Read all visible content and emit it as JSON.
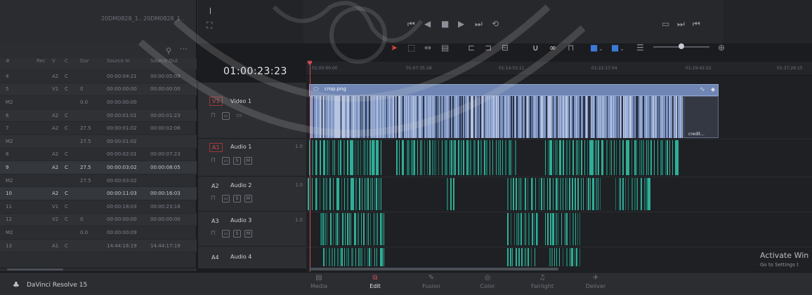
{
  "media_pool": {
    "thumb_labels": [
      "20DM0828_1..",
      "20DM0828_1.."
    ],
    "columns": [
      "#",
      "Rec",
      "V",
      "C",
      "Dur",
      "Source In",
      "Source Out"
    ],
    "rows": [
      {
        "num": "4",
        "v": "A2",
        "c": "C",
        "dur": "",
        "src_in": "00:00:04:21",
        "src_out": "00:00:05:09"
      },
      {
        "num": "5",
        "v": "V1",
        "c": "C",
        "dur": "0",
        "src_in": "00:00:00:00",
        "src_out": "00:00:00:00"
      },
      {
        "num": "M2",
        "v": "",
        "c": "",
        "dur": "0.0",
        "src_in": "00:00:00:00",
        "src_out": ""
      },
      {
        "num": "6",
        "v": "A2",
        "c": "C",
        "dur": "",
        "src_in": "00:00:01:01",
        "src_out": "00:00:01:23"
      },
      {
        "num": "7",
        "v": "A2",
        "c": "C",
        "dur": "27.5",
        "src_in": "00:00:01:02",
        "src_out": "00:00:02:06"
      },
      {
        "num": "M2",
        "v": "",
        "c": "",
        "dur": "27.5",
        "src_in": "00:00:01:02",
        "src_out": ""
      },
      {
        "num": "8",
        "v": "A2",
        "c": "C",
        "dur": "",
        "src_in": "00:00:02:01",
        "src_out": "00:00:07:23"
      },
      {
        "num": "9",
        "v": "A2",
        "c": "C",
        "dur": "27.5",
        "src_in": "00:00:03:02",
        "src_out": "00:00:08:05"
      },
      {
        "num": "M2",
        "v": "",
        "c": "",
        "dur": "27.5",
        "src_in": "00:00:03:02",
        "src_out": ""
      },
      {
        "num": "10",
        "v": "A2",
        "c": "C",
        "dur": "",
        "src_in": "00:00:11:03",
        "src_out": "00:00:16:03"
      },
      {
        "num": "11",
        "v": "V1",
        "c": "C",
        "dur": "",
        "src_in": "00:00:18:03",
        "src_out": "00:00:23:18"
      },
      {
        "num": "12",
        "v": "V2",
        "c": "C",
        "dur": "0",
        "src_in": "00:00:00:00",
        "src_out": "00:00:00:00"
      },
      {
        "num": "M2",
        "v": "",
        "c": "",
        "dur": "0.0",
        "src_in": "00:00:00:09",
        "src_out": ""
      },
      {
        "num": "13",
        "v": "A1",
        "c": "C",
        "dur": "",
        "src_in": "14:44:16:19",
        "src_out": "14:44:17:19"
      }
    ]
  },
  "timeline": {
    "timecode": "01:00:23:23",
    "ruler": [
      "01:00:00:00",
      "01:07:35:18",
      "01:14:53:11",
      "01:22:17:04",
      "01:29:42:22",
      "01:37:29:15"
    ],
    "clip_name": "crop.png",
    "credits_label": "credit..."
  },
  "tracks": [
    {
      "id": "V1",
      "name": "Video 1",
      "count": "",
      "kind": "video"
    },
    {
      "id": "A1",
      "name": "Audio 1",
      "count": "1.0",
      "kind": "audio"
    },
    {
      "id": "A2",
      "name": "Audio 2",
      "count": "1.0",
      "kind": "audio"
    },
    {
      "id": "A3",
      "name": "Audio 3",
      "count": "1.0",
      "kind": "audio"
    },
    {
      "id": "A4",
      "name": "Audio 4",
      "count": "",
      "kind": "audio"
    }
  ],
  "track_buttons": {
    "solo": "S",
    "mute": "M"
  },
  "pages": [
    {
      "label": "Media",
      "icon": "media-icon",
      "active": false
    },
    {
      "label": "Edit",
      "icon": "edit-icon",
      "active": true
    },
    {
      "label": "Fusion",
      "icon": "fusion-icon",
      "active": false
    },
    {
      "label": "Color",
      "icon": "color-icon",
      "active": false
    },
    {
      "label": "Fairlight",
      "icon": "fairlight-icon",
      "active": false
    },
    {
      "label": "Deliver",
      "icon": "deliver-icon",
      "active": false
    }
  ],
  "app_name": "DaVinci Resolve 15",
  "activation": {
    "title": "Activate Win",
    "subtitle": "Go to Settings t"
  },
  "colors": {
    "accent": "#d44a58",
    "video_clip": "#6f86b4",
    "audio_clip": "#2fae98",
    "selection": "#3b7bd8"
  }
}
